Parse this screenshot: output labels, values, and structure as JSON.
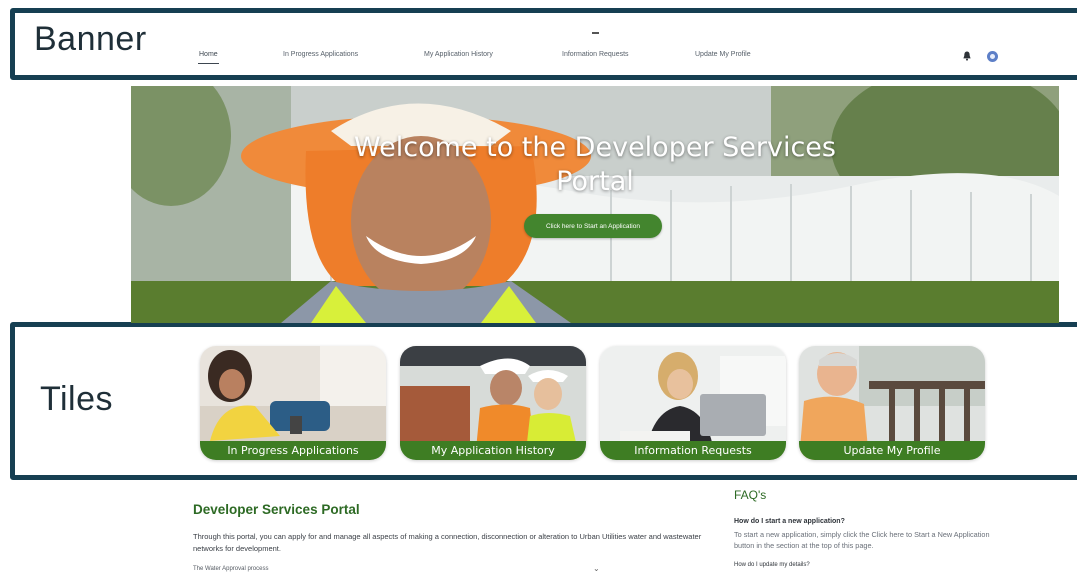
{
  "callouts": {
    "banner_label": "Banner",
    "tiles_label": "Tiles"
  },
  "nav": {
    "items": [
      {
        "label": "Home",
        "active": true
      },
      {
        "label": "In Progress Applications",
        "active": false
      },
      {
        "label": "My Application History",
        "active": false
      },
      {
        "label": "Information Requests",
        "active": false
      },
      {
        "label": "Update My Profile",
        "active": false
      }
    ],
    "icons": [
      "bell-icon",
      "user-avatar-icon"
    ]
  },
  "hero": {
    "title_line1": "Welcome to the Developer Services",
    "title_line2": "Portal",
    "cta_label": "Click here to Start an Application"
  },
  "tiles": [
    {
      "label": "In Progress Applications"
    },
    {
      "label": "My Application History"
    },
    {
      "label": "Information Requests"
    },
    {
      "label": "Update My Profile"
    }
  ],
  "content": {
    "title": "Developer Services Portal",
    "body": "Through this portal, you can apply for and manage all aspects of making a connection, disconnection or alteration to Urban Utilities water and wastewater networks for development.",
    "subheading": "The Water Approval process"
  },
  "faq": {
    "title": "FAQ's",
    "q1": "How do I start a new application?",
    "a1": "To start a new application, simply click the Click here to Start a New Application button in the section at the top of this page.",
    "q2": "How do I update my details?"
  },
  "colors": {
    "brand_green": "#3e7d23",
    "callout_border": "#163f52"
  }
}
